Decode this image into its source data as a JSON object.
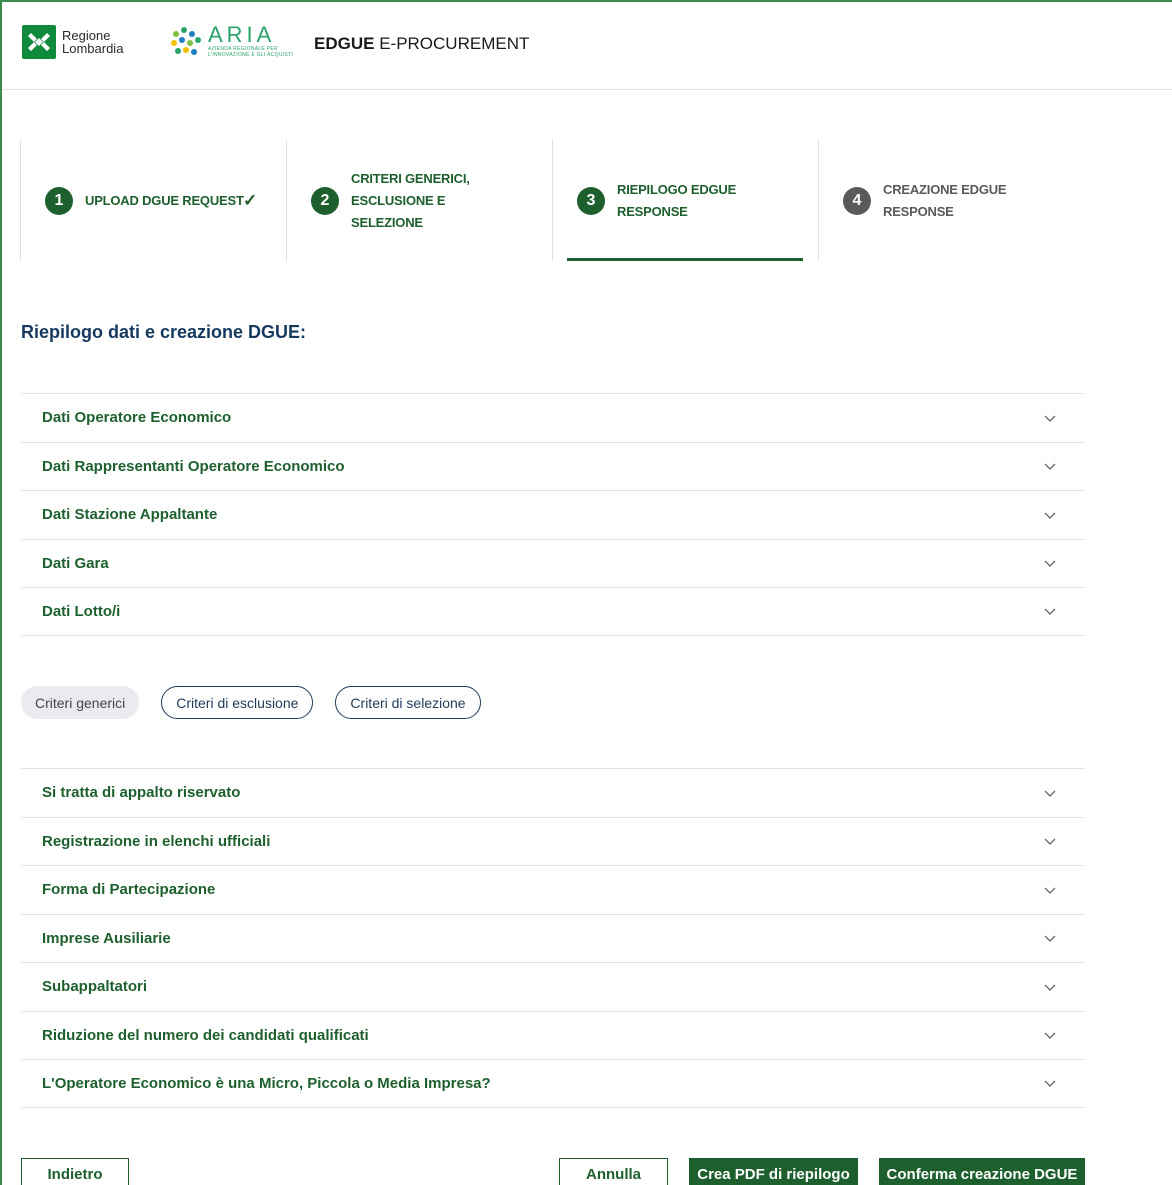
{
  "header": {
    "logo_rl_line1": "Regione",
    "logo_rl_line2": "Lombardia",
    "logo_aria": "ARIA",
    "logo_aria_sub1": "AZIENDA REGIONALE PER",
    "logo_aria_sub2": "L'INNOVAZIONE E GLI ACQUISTI",
    "title_bold": "EDGUE",
    "title_rest": " E-PROCUREMENT"
  },
  "stepper": {
    "steps": [
      {
        "num": "1",
        "label": "UPLOAD DGUE REQUEST",
        "state": "done"
      },
      {
        "num": "2",
        "label": "CRITERI GENERICI, ESCLUSIONE E SELEZIONE",
        "state": "done"
      },
      {
        "num": "3",
        "label": "RIEPILOGO EDGUE RESPONSE",
        "state": "active"
      },
      {
        "num": "4",
        "label": "CREAZIONE EDGUE RESPONSE",
        "state": "pending"
      }
    ]
  },
  "section_title": "Riepilogo dati e creazione DGUE:",
  "data_sections": [
    "Dati Operatore Economico",
    "Dati Rappresentanti Operatore Economico",
    "Dati Stazione Appaltante",
    "Dati Gara",
    "Dati Lotto/i"
  ],
  "tabs": [
    {
      "label": "Criteri generici",
      "active": true
    },
    {
      "label": "Criteri di esclusione",
      "active": false
    },
    {
      "label": "Criteri di selezione",
      "active": false
    }
  ],
  "criteria_sections": [
    "Si tratta di appalto riservato",
    "Registrazione in elenchi ufficiali",
    "Forma di Partecipazione",
    "Imprese Ausiliarie",
    "Subappaltatori",
    "Riduzione del numero dei candidati qualificati",
    "L'Operatore Economico è una Micro, Piccola o Media Impresa?"
  ],
  "buttons": {
    "back": "Indietro",
    "cancel": "Annulla",
    "pdf": "Crea PDF di riepilogo",
    "confirm": "Conferma creazione DGUE"
  },
  "colors": {
    "primary_green": "#1e5f2e",
    "navy": "#163a5f",
    "pending_gray": "#5a5a5a"
  }
}
